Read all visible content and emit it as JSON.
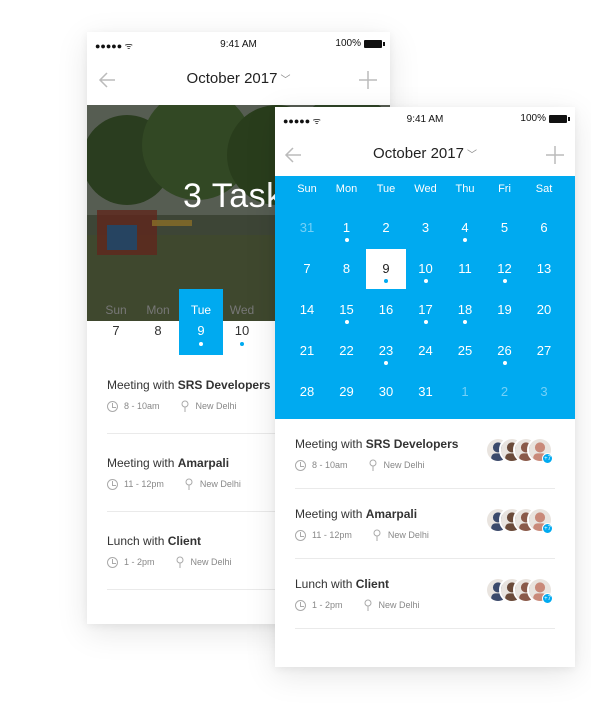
{
  "status": {
    "time": "9:41 AM",
    "battery": "100%"
  },
  "back_phone": {
    "title": "October 2017",
    "banner_text": "3 Task",
    "days": [
      {
        "name": "Sun",
        "num": "7",
        "active": false,
        "dot": false
      },
      {
        "name": "Mon",
        "num": "8",
        "active": false,
        "dot": false
      },
      {
        "name": "Tue",
        "num": "9",
        "active": true,
        "dot": true
      },
      {
        "name": "Wed",
        "num": "10",
        "active": false,
        "dot": true
      }
    ],
    "tasks": [
      {
        "prefix": "Meeting with ",
        "who": "SRS Developers",
        "time": "8 - 10am",
        "place": "New Delhi"
      },
      {
        "prefix": "Meeting with ",
        "who": "Amarpali",
        "time": "11 - 12pm",
        "place": "New Delhi"
      },
      {
        "prefix": "Lunch with ",
        "who": "Client",
        "time": "1 - 2pm",
        "place": "New Delhi"
      }
    ]
  },
  "front_phone": {
    "title": "October 2017",
    "weekdays": [
      "Sun",
      "Mon",
      "Tue",
      "Wed",
      "Thu",
      "Fri",
      "Sat"
    ],
    "weeks": [
      [
        {
          "n": "31",
          "m": true
        },
        {
          "n": "1",
          "dot": true
        },
        {
          "n": "2"
        },
        {
          "n": "3"
        },
        {
          "n": "4",
          "dot": true
        },
        {
          "n": "5"
        },
        {
          "n": "6"
        }
      ],
      [
        {
          "n": "7"
        },
        {
          "n": "8"
        },
        {
          "n": "9",
          "dot": true,
          "today": true
        },
        {
          "n": "10",
          "dot": true
        },
        {
          "n": "11"
        },
        {
          "n": "12",
          "dot": true
        },
        {
          "n": "13"
        }
      ],
      [
        {
          "n": "14"
        },
        {
          "n": "15",
          "dot": true
        },
        {
          "n": "16"
        },
        {
          "n": "17",
          "dot": true
        },
        {
          "n": "18",
          "dot": true
        },
        {
          "n": "19"
        },
        {
          "n": "20"
        }
      ],
      [
        {
          "n": "21"
        },
        {
          "n": "22"
        },
        {
          "n": "23",
          "dot": true
        },
        {
          "n": "24"
        },
        {
          "n": "25"
        },
        {
          "n": "26",
          "dot": true
        },
        {
          "n": "27"
        }
      ],
      [
        {
          "n": "28"
        },
        {
          "n": "29"
        },
        {
          "n": "30"
        },
        {
          "n": "31"
        },
        {
          "n": "1",
          "m": true
        },
        {
          "n": "2",
          "m": true
        },
        {
          "n": "3",
          "m": true
        }
      ]
    ],
    "tasks": [
      {
        "prefix": "Meeting with ",
        "who": "SRS Developers",
        "time": "8 - 10am",
        "place": "New Delhi",
        "more": "+7"
      },
      {
        "prefix": "Meeting with ",
        "who": "Amarpali",
        "time": "11 - 12pm",
        "place": "New Delhi",
        "more": "+7"
      },
      {
        "prefix": "Lunch with ",
        "who": "Client",
        "time": "1 - 2pm",
        "place": "New Delhi",
        "more": "+7"
      }
    ]
  },
  "colors": {
    "accent": "#00aaf0"
  }
}
